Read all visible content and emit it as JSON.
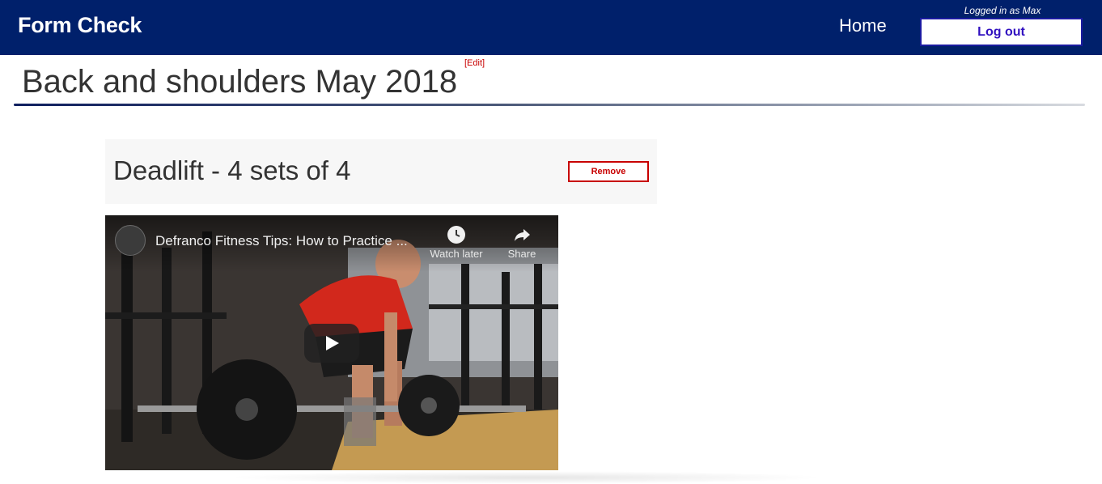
{
  "navbar": {
    "brand": "Form Check",
    "home_label": "Home",
    "logged_in_text": "Logged in as Max",
    "logout_label": "Log out"
  },
  "page": {
    "title": "Back and shoulders May 2018",
    "edit_label": "[Edit]"
  },
  "exercises": [
    {
      "title": "Deadlift - 4 sets of 4",
      "remove_label": "Remove",
      "video": {
        "title": "Defranco Fitness Tips: How to Practice ...",
        "watch_later_label": "Watch later",
        "share_label": "Share"
      }
    }
  ],
  "colors": {
    "navbar": "#00206b",
    "accent_red": "#c80000",
    "logout_text": "#3010c0"
  },
  "icons": [
    "clock-icon",
    "share-arrow-icon",
    "play-icon",
    "channel-logo"
  ]
}
